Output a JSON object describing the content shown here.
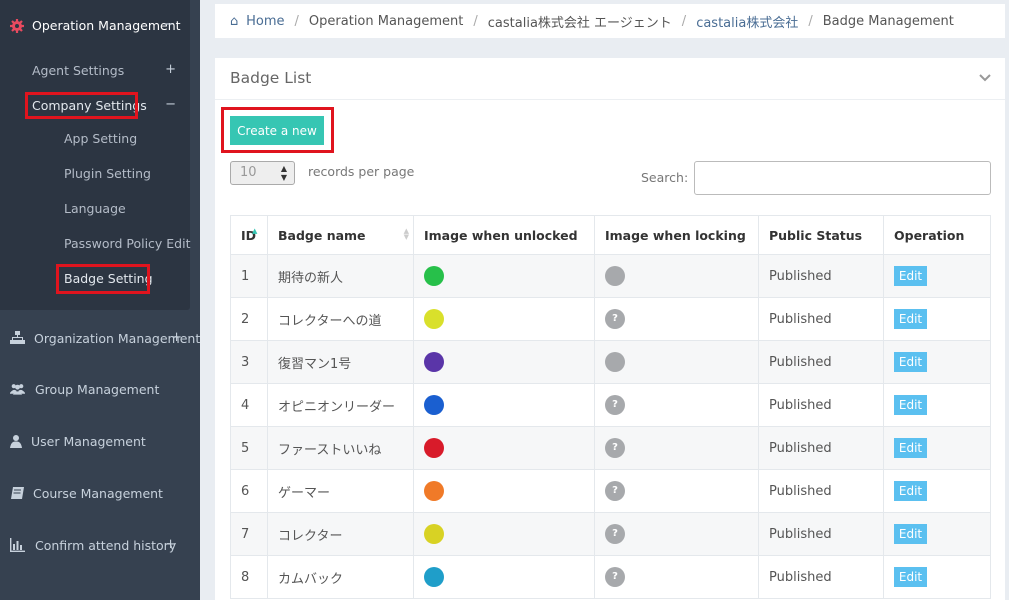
{
  "sidebar": {
    "operation_management": "Operation Management",
    "operation_toggle": "−",
    "agent_settings": "Agent Settings",
    "agent_toggle": "+",
    "company_settings": "Company Settings",
    "company_toggle": "−",
    "sub_items": [
      "App Setting",
      "Plugin Setting",
      "Language",
      "Password Policy Edit",
      "Badge Setting"
    ],
    "organization_management": "Organization Management",
    "organization_toggle": "+",
    "group_management": "Group Management",
    "user_management": "User Management",
    "course_management": "Course Management",
    "confirm_attend_history": "Confirm attend history",
    "confirm_toggle": "+"
  },
  "breadcrumb": {
    "home": "Home",
    "items": [
      "Operation Management",
      "castalia株式会社 エージェント",
      "castalia株式会社",
      "Badge Management"
    ]
  },
  "panel": {
    "title": "Badge List",
    "create_button": "Create a new",
    "records_per_page_value": "10",
    "records_per_page_label": "records per page",
    "search_label": "Search:",
    "search_value": ""
  },
  "table": {
    "headers": [
      "ID",
      "Badge name",
      "Image when unlocked",
      "Image when locking",
      "Public Status",
      "Operation"
    ],
    "rows": [
      {
        "id": "1",
        "name": "期待の新人",
        "status": "Published",
        "op": "Edit",
        "icon_color": "#27c04a",
        "lock_mark": ""
      },
      {
        "id": "2",
        "name": "コレクターへの道",
        "status": "Published",
        "op": "Edit",
        "icon_color": "#d9e02b",
        "lock_mark": "?"
      },
      {
        "id": "3",
        "name": "復習マン1号",
        "status": "Published",
        "op": "Edit",
        "icon_color": "#5a35a8",
        "lock_mark": ""
      },
      {
        "id": "4",
        "name": "オピニオンリーダー",
        "status": "Published",
        "op": "Edit",
        "icon_color": "#1a5fd0",
        "lock_mark": "?"
      },
      {
        "id": "5",
        "name": "ファーストいいね",
        "status": "Published",
        "op": "Edit",
        "icon_color": "#d81b2a",
        "lock_mark": "?"
      },
      {
        "id": "6",
        "name": "ゲーマー",
        "status": "Published",
        "op": "Edit",
        "icon_color": "#f07a28",
        "lock_mark": "?"
      },
      {
        "id": "7",
        "name": "コレクター",
        "status": "Published",
        "op": "Edit",
        "icon_color": "#d8d224",
        "lock_mark": "?"
      },
      {
        "id": "8",
        "name": "カムバック",
        "status": "Published",
        "op": "Edit",
        "icon_color": "#1f9ec9",
        "lock_mark": "?"
      }
    ]
  },
  "colors": {
    "sidebar_bg": "#364150",
    "accent_teal": "#36c6b3",
    "edit_blue": "#5bc0f0",
    "highlight_red": "#e0141e"
  }
}
